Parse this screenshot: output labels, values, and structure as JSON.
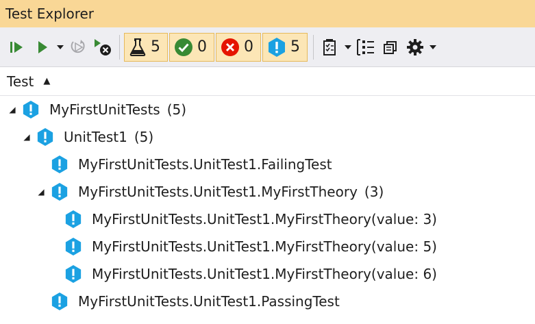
{
  "window": {
    "title": "Test Explorer"
  },
  "toolbar": {
    "buttons": [
      {
        "name": "run-all-icon"
      },
      {
        "name": "run-icon"
      },
      {
        "name": "dropdown-arrow-icon"
      },
      {
        "name": "repeat-last-run-icon"
      },
      {
        "name": "cancel-icon"
      }
    ],
    "filters": [
      {
        "icon": "flask-icon",
        "count": "5"
      },
      {
        "icon": "passed-icon",
        "count": "0"
      },
      {
        "icon": "failed-icon",
        "count": "0"
      },
      {
        "icon": "not-run-icon",
        "count": "5"
      }
    ],
    "right_buttons": [
      {
        "name": "playlist-icon"
      },
      {
        "name": "group-by-icon"
      },
      {
        "name": "copy-icon"
      },
      {
        "name": "settings-icon"
      }
    ]
  },
  "column": {
    "label": "Test"
  },
  "tree": [
    {
      "label": "MyFirstUnitTests",
      "count": "(5)",
      "level": 0,
      "expanded": true
    },
    {
      "label": "UnitTest1",
      "count": "(5)",
      "level": 1,
      "expanded": true
    },
    {
      "label": "MyFirstUnitTests.UnitTest1.FailingTest",
      "count": "",
      "level": 2
    },
    {
      "label": "MyFirstUnitTests.UnitTest1.MyFirstTheory",
      "count": "(3)",
      "level": 2,
      "expanded": true
    },
    {
      "label": "MyFirstUnitTests.UnitTest1.MyFirstTheory(value: 3)",
      "count": "",
      "level": 3
    },
    {
      "label": "MyFirstUnitTests.UnitTest1.MyFirstTheory(value: 5)",
      "count": "",
      "level": 3
    },
    {
      "label": "MyFirstUnitTests.UnitTest1.MyFirstTheory(value: 6)",
      "count": "",
      "level": 3
    },
    {
      "label": "MyFirstUnitTests.UnitTest1.PassingTest",
      "count": "",
      "level": 2
    }
  ],
  "colors": {
    "title_bg": "#f9d796",
    "toolbar_bg": "#eeeef2",
    "filter_bg": "#fce6b6",
    "notrun_blue": "#1ba1e2",
    "pass_green": "#388a34",
    "fail_red": "#e51400"
  }
}
